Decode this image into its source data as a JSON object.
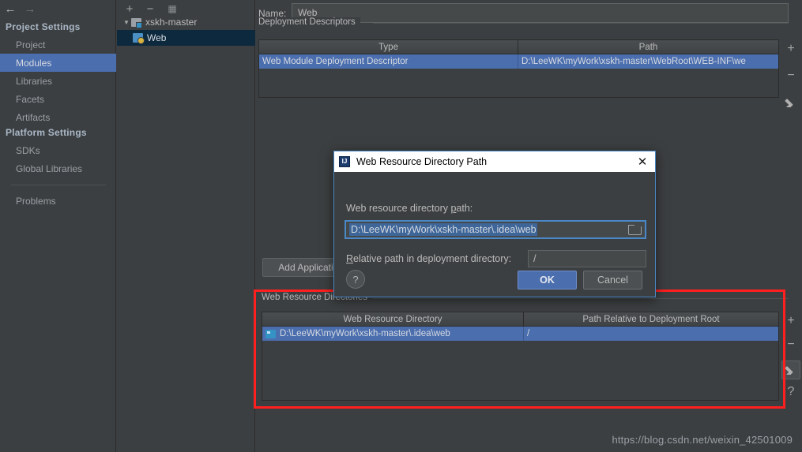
{
  "window": {
    "nav": {
      "back_icon": "arrow-left-icon",
      "forward_icon": "arrow-right-icon"
    }
  },
  "sidebar": {
    "sections": [
      {
        "title": "Project Settings"
      },
      {
        "title": "Platform Settings"
      }
    ],
    "project_settings_items": [
      {
        "label": "Project",
        "selected": false
      },
      {
        "label": "Modules",
        "selected": true
      },
      {
        "label": "Libraries",
        "selected": false
      },
      {
        "label": "Facets",
        "selected": false
      },
      {
        "label": "Artifacts",
        "selected": false
      }
    ],
    "platform_settings_items": [
      {
        "label": "SDKs",
        "selected": false
      },
      {
        "label": "Global Libraries",
        "selected": false
      }
    ],
    "other_items": [
      {
        "label": "Problems",
        "selected": false
      }
    ]
  },
  "tree": {
    "toolbar": {
      "add_label": "+",
      "remove_label": "−",
      "copy_icon": "copy-icon"
    },
    "nodes": [
      {
        "label": "xskh-master",
        "expanded_glyph": "▼",
        "selected": false,
        "icon": "module-folder-icon"
      },
      {
        "label": "Web",
        "selected": true,
        "icon": "web-facet-icon"
      }
    ]
  },
  "main": {
    "name_label_pre": "Na",
    "name_label_mid": "m",
    "name_label_post": "e:",
    "name_value": "Web",
    "deployment_descriptors": {
      "group_label": "Deployment Descriptors",
      "columns": [
        "Type",
        "Path"
      ],
      "rows": [
        {
          "type": "Web Module Deployment Descriptor",
          "path": "D:\\LeeWK\\myWork\\xskh-master\\WebRoot\\WEB-INF\\we",
          "selected": true
        }
      ],
      "actions": [
        {
          "name": "add-descriptor-button",
          "glyph": "+"
        },
        {
          "name": "remove-descriptor-button",
          "glyph": "−"
        },
        {
          "name": "edit-descriptor-button",
          "glyph": "pencil"
        }
      ]
    },
    "add_application_button": "Add Applicati",
    "help_button": "?",
    "web_resource_directories": {
      "group_label": "Web Resource Directories",
      "columns": [
        "Web Resource Directory",
        "Path Relative to Deployment Root"
      ],
      "rows": [
        {
          "directory": "D:\\LeeWK\\myWork\\xskh-master\\.idea\\web",
          "relative_path": "/",
          "selected": true
        }
      ],
      "actions": [
        {
          "name": "add-web-resource-button",
          "glyph": "+"
        },
        {
          "name": "remove-web-resource-button",
          "glyph": "−"
        },
        {
          "name": "edit-web-resource-button",
          "glyph": "pencil"
        },
        {
          "name": "web-resource-help-button",
          "glyph": "?"
        }
      ]
    }
  },
  "dialog": {
    "title": "Web Resource Directory Path",
    "title_icon": "intellij-idea-icon",
    "close_icon": "close-icon",
    "path_label_pre": "Web resource directory ",
    "path_label_underlined": "p",
    "path_label_post": "ath:",
    "path_value": "D:\\LeeWK\\myWork\\xskh-master\\.idea\\web",
    "browse_icon": "folder-browse-icon",
    "relative_label_underlined": "R",
    "relative_label_rest": "elative path in deployment directory:",
    "relative_value": "/",
    "help_label": "?",
    "ok_label": "OK",
    "cancel_label": "Cancel"
  },
  "watermark": "https://blog.csdn.net/weixin_42501009",
  "colors": {
    "background": "#3c3f41",
    "selection_blue": "#4b6eaf",
    "tree_selection": "#0d293e",
    "annotation_red": "#ff1f1f",
    "dialog_border": "#4a88c7",
    "text": "#bbbbbb"
  }
}
